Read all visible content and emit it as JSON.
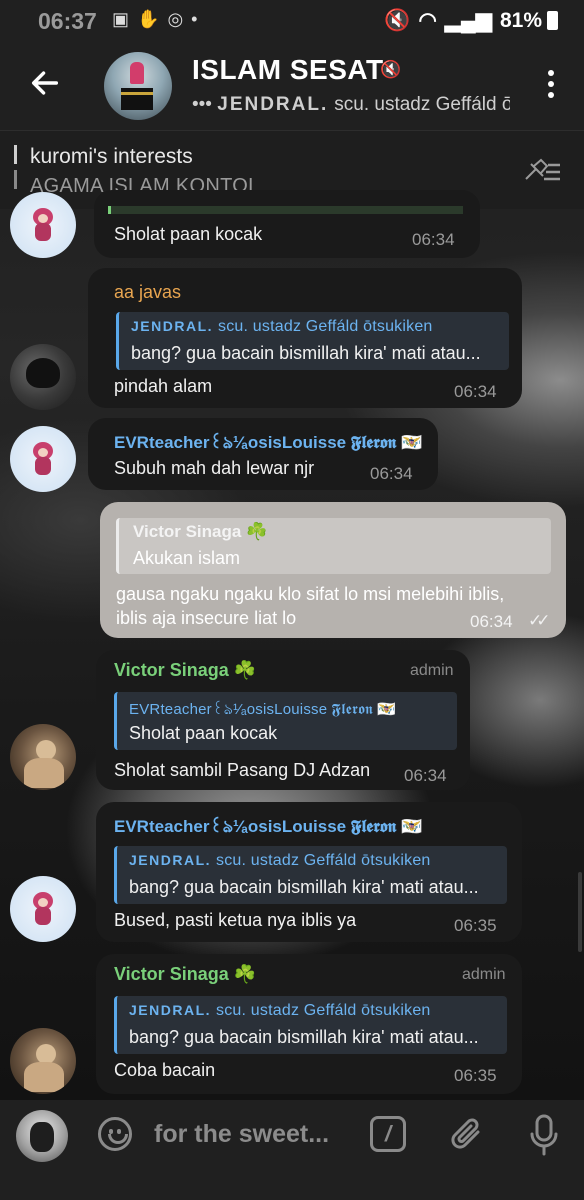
{
  "status_bar": {
    "time": "06:37",
    "left_icons": [
      "image-icon",
      "hand-icon",
      "instagram-icon",
      "dot-icon"
    ],
    "battery_percent": "81%"
  },
  "header": {
    "title": "ISLAM SESAT",
    "subtitle_prefix": "•••",
    "subtitle_caps": "JENDRAL.",
    "subtitle": "scu. ustadz Geffáld ōtsukiken"
  },
  "pinned": {
    "title": "kuromi's interests",
    "text": "AGAMA ISLAM KONTOL"
  },
  "messages": [
    {
      "id": "m1",
      "direction": "in",
      "text": "Sholat paan kocak",
      "time": "06:34"
    },
    {
      "id": "m2",
      "direction": "in",
      "sender": "aa javas",
      "sender_color": "#e8a550",
      "reply": {
        "name_caps": "JENDRAL.",
        "name": "scu. ustadz Geffáld ōtsukiken",
        "text": "bang? gua bacain bismillah kira' mati atau..."
      },
      "text": "pindah alam",
      "time": "06:34"
    },
    {
      "id": "m3",
      "direction": "in",
      "sender": "EVRteacher꒰ঌ¹⁄ₐosisLouisse 𝕱𝖑𝖊𝖗𝖔𝖓 🇻🇮",
      "sender_color": "#6cb3f0",
      "text": "Subuh mah dah lewar njr",
      "time": "06:34"
    },
    {
      "id": "m4",
      "direction": "out",
      "reply": {
        "name": "Victor Sinaga ☘️",
        "text": "Akukan islam"
      },
      "text_line1": "gausa ngaku ngaku klo sifat lo msi melebihi iblis,",
      "text_line2": "iblis aja insecure liat lo",
      "time": "06:34",
      "checks": "✓✓"
    },
    {
      "id": "m5",
      "direction": "in",
      "sender": "Victor Sinaga ☘️",
      "sender_color": "#7ad07a",
      "badge": "admin",
      "reply": {
        "name": "EVRteacher꒰ঌ¹⁄ₐosisLouisse 𝕱𝖑𝖊𝖗𝖔𝖓 🇻🇮",
        "text": "Sholat paan kocak"
      },
      "text": "Sholat sambil Pasang DJ Adzan",
      "time": "06:34"
    },
    {
      "id": "m6",
      "direction": "in",
      "sender": "EVRteacher꒰ঌ¹⁄ₐosisLouisse 𝕱𝖑𝖊𝖗𝖔𝖓 🇻🇮",
      "sender_color": "#6cb3f0",
      "reply": {
        "name_caps": "JENDRAL.",
        "name": "scu. ustadz Geffáld ōtsukiken",
        "text": "bang? gua bacain bismillah kira' mati atau..."
      },
      "text": "Bused, pasti ketua nya iblis ya",
      "time": "06:35"
    },
    {
      "id": "m7",
      "direction": "in",
      "sender": "Victor Sinaga ☘️",
      "sender_color": "#7ad07a",
      "badge": "admin",
      "reply": {
        "name_caps": "JENDRAL.",
        "name": "scu. ustadz Geffáld ōtsukiken",
        "text": "bang? gua bacain bismillah kira' mati atau..."
      },
      "text": "Coba bacain",
      "time": "06:35"
    }
  ],
  "input": {
    "placeholder": "for the sweet..."
  },
  "colors": {
    "header_bg": "#202020",
    "bubble_in": "#1a1a1a",
    "bubble_out": "#b6b2ae",
    "reply_accent": "#5aa8ea"
  }
}
